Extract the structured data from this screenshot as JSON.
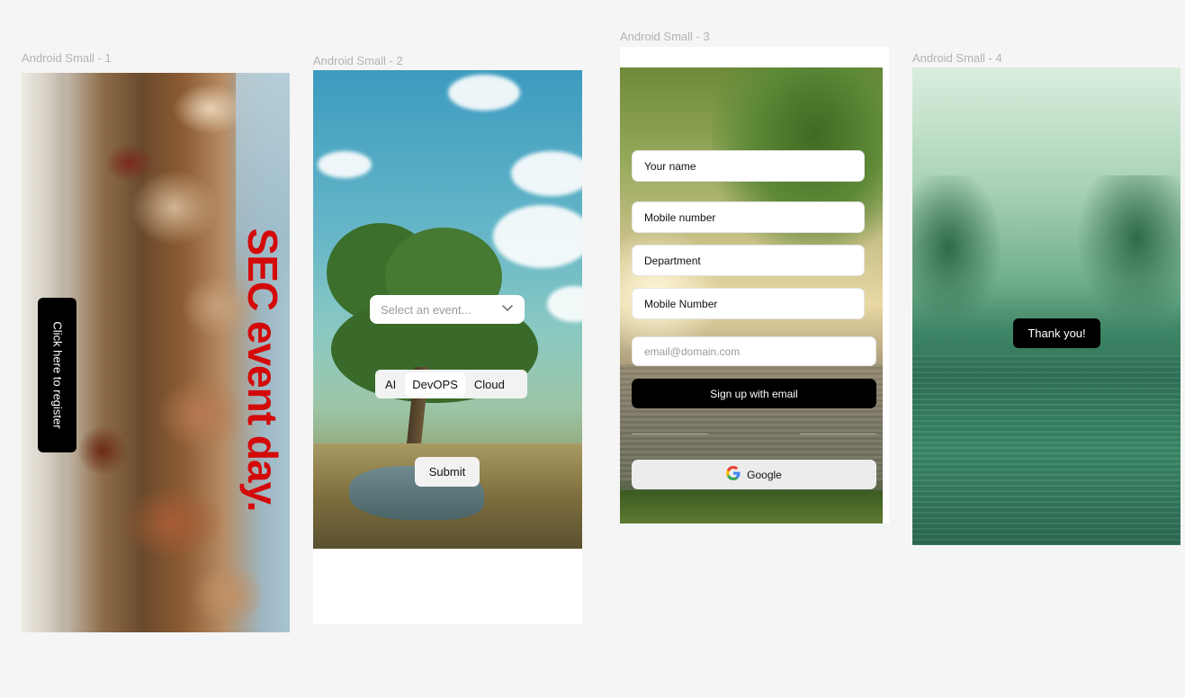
{
  "frames": {
    "f1": {
      "label": "Android Small - 1",
      "register_button": "Click here to register",
      "headline": "SEC event day."
    },
    "f2": {
      "label": "Android Small - 2",
      "select_placeholder": "Select an event...",
      "options": [
        "AI",
        "DevOPS",
        "Cloud"
      ],
      "selected_option": "DevOPS",
      "submit": "Submit"
    },
    "f3": {
      "label": "Android Small - 3",
      "fields": {
        "name": "Your name",
        "mobile": "Mobile number",
        "department": "Department",
        "mobile2": "Mobile Number",
        "email": "email@domain.com"
      },
      "signup_button": "Sign up with email",
      "google_button": "Google"
    },
    "f4": {
      "label": "Android Small - 4",
      "message": "Thank you!"
    }
  },
  "colors": {
    "canvas": "#f5f5f5",
    "accent_red": "#d40a0a",
    "button_dark": "#000000",
    "label_gray": "#b3b3b3"
  },
  "icons": [
    "chevron-down-icon",
    "google-logo-icon"
  ]
}
